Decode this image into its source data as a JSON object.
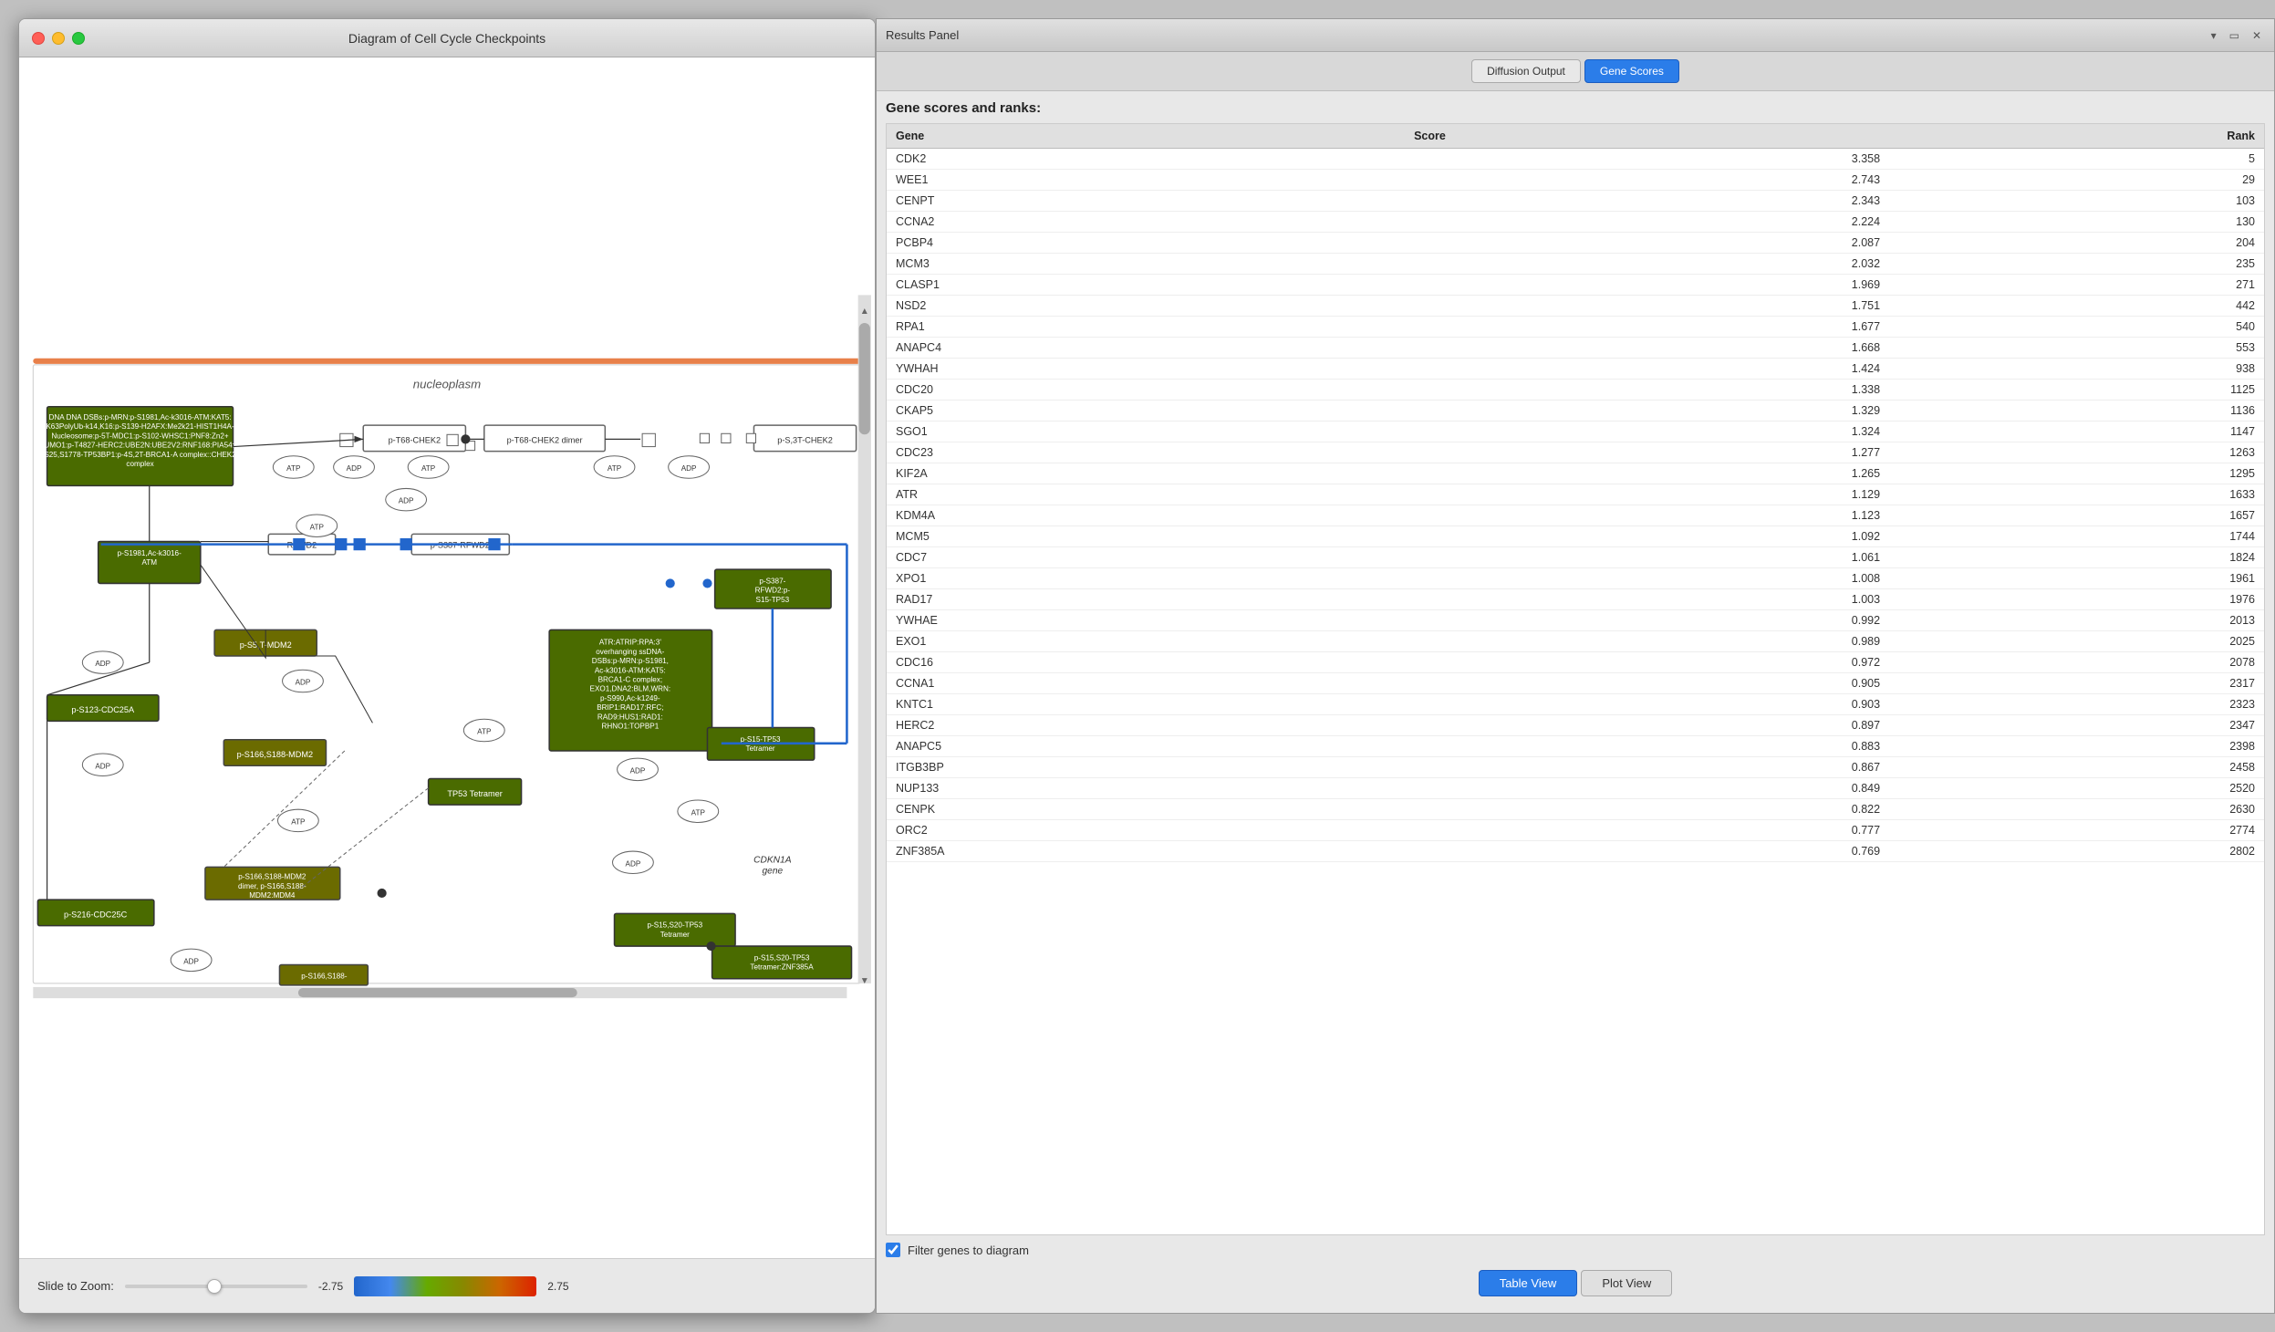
{
  "window": {
    "title": "Diagram of Cell Cycle Checkpoints"
  },
  "results_panel": {
    "title": "Results Panel",
    "tabs": [
      {
        "label": "Diffusion Output",
        "active": false
      },
      {
        "label": "Gene Scores",
        "active": true
      }
    ],
    "section_title": "Gene scores and ranks:",
    "table": {
      "headers": [
        "Gene",
        "Score",
        "Rank"
      ],
      "rows": [
        {
          "gene": "CDK2",
          "score": "3.358",
          "rank": "5"
        },
        {
          "gene": "WEE1",
          "score": "2.743",
          "rank": "29"
        },
        {
          "gene": "CENPT",
          "score": "2.343",
          "rank": "103"
        },
        {
          "gene": "CCNA2",
          "score": "2.224",
          "rank": "130"
        },
        {
          "gene": "PCBP4",
          "score": "2.087",
          "rank": "204"
        },
        {
          "gene": "MCM3",
          "score": "2.032",
          "rank": "235"
        },
        {
          "gene": "CLASP1",
          "score": "1.969",
          "rank": "271"
        },
        {
          "gene": "NSD2",
          "score": "1.751",
          "rank": "442"
        },
        {
          "gene": "RPA1",
          "score": "1.677",
          "rank": "540"
        },
        {
          "gene": "ANAPC4",
          "score": "1.668",
          "rank": "553"
        },
        {
          "gene": "YWHAH",
          "score": "1.424",
          "rank": "938"
        },
        {
          "gene": "CDC20",
          "score": "1.338",
          "rank": "1125"
        },
        {
          "gene": "CKAP5",
          "score": "1.329",
          "rank": "1136"
        },
        {
          "gene": "SGO1",
          "score": "1.324",
          "rank": "1147"
        },
        {
          "gene": "CDC23",
          "score": "1.277",
          "rank": "1263"
        },
        {
          "gene": "KIF2A",
          "score": "1.265",
          "rank": "1295"
        },
        {
          "gene": "ATR",
          "score": "1.129",
          "rank": "1633"
        },
        {
          "gene": "KDM4A",
          "score": "1.123",
          "rank": "1657"
        },
        {
          "gene": "MCM5",
          "score": "1.092",
          "rank": "1744"
        },
        {
          "gene": "CDC7",
          "score": "1.061",
          "rank": "1824"
        },
        {
          "gene": "XPO1",
          "score": "1.008",
          "rank": "1961"
        },
        {
          "gene": "RAD17",
          "score": "1.003",
          "rank": "1976"
        },
        {
          "gene": "YWHAE",
          "score": "0.992",
          "rank": "2013"
        },
        {
          "gene": "EXO1",
          "score": "0.989",
          "rank": "2025"
        },
        {
          "gene": "CDC16",
          "score": "0.972",
          "rank": "2078"
        },
        {
          "gene": "CCNA1",
          "score": "0.905",
          "rank": "2317"
        },
        {
          "gene": "KNTC1",
          "score": "0.903",
          "rank": "2323"
        },
        {
          "gene": "HERC2",
          "score": "0.897",
          "rank": "2347"
        },
        {
          "gene": "ANAPC5",
          "score": "0.883",
          "rank": "2398"
        },
        {
          "gene": "ITGB3BP",
          "score": "0.867",
          "rank": "2458"
        },
        {
          "gene": "NUP133",
          "score": "0.849",
          "rank": "2520"
        },
        {
          "gene": "CENPK",
          "score": "0.822",
          "rank": "2630"
        },
        {
          "gene": "ORC2",
          "score": "0.777",
          "rank": "2774"
        },
        {
          "gene": "ZNF385A",
          "score": "0.769",
          "rank": "2802"
        }
      ]
    },
    "filter": {
      "checked": true,
      "label": "Filter genes to diagram"
    },
    "bottom_buttons": [
      {
        "label": "Table View",
        "active": true
      },
      {
        "label": "Plot View",
        "active": false
      }
    ]
  },
  "zoom": {
    "label": "Slide to Zoom:",
    "value_left": "-2.75",
    "value_right": "2.75"
  },
  "diagram": {
    "nucleoplasm_label": "nucleoplasm"
  }
}
